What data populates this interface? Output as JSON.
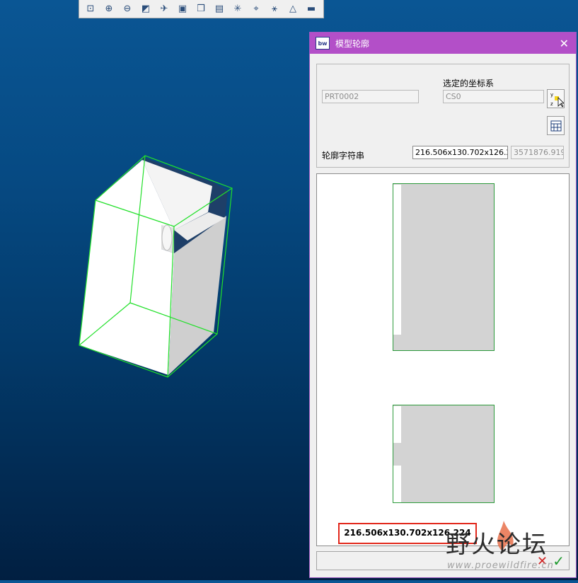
{
  "toolbar": {
    "icons": [
      "zoom-fit-icon",
      "zoom-in-icon",
      "zoom-out-icon",
      "refit-icon",
      "view-orient-icon",
      "saved-views-icon",
      "layers-icon",
      "camera-icon",
      "datum-display-icon",
      "csys-display-icon",
      "spin-center-icon",
      "shading-icon",
      "display-style-icon"
    ],
    "glyphs": [
      "⊡",
      "⊕",
      "⊖",
      "◩",
      "✈",
      "▣",
      "❒",
      "▤",
      "✳",
      "⌖",
      "⚹",
      "△",
      "▬"
    ]
  },
  "dialog": {
    "app_icon_text": "bw",
    "title": "模型轮廓",
    "close_glyph": "✕",
    "model_name": "PRT0002",
    "coord_label": "选定的坐标系",
    "coord_value": "CS0",
    "outline_label": "轮廓字符串",
    "outline_value": "216.506x130.702x126.224",
    "volume_value": "3571876.919",
    "preview_dimension_text": "216.506x130.702x126.224",
    "cancel_glyph": "✕",
    "ok_glyph": "✓"
  },
  "watermark": {
    "title": "野火论坛",
    "url": "www.proewildfire.cn"
  },
  "colors": {
    "titlebar": "#b34fc8",
    "bbox_green": "#22e02a",
    "highlight_red": "#e2281c",
    "background_top": "#0a5694",
    "background_bottom": "#011f41"
  }
}
